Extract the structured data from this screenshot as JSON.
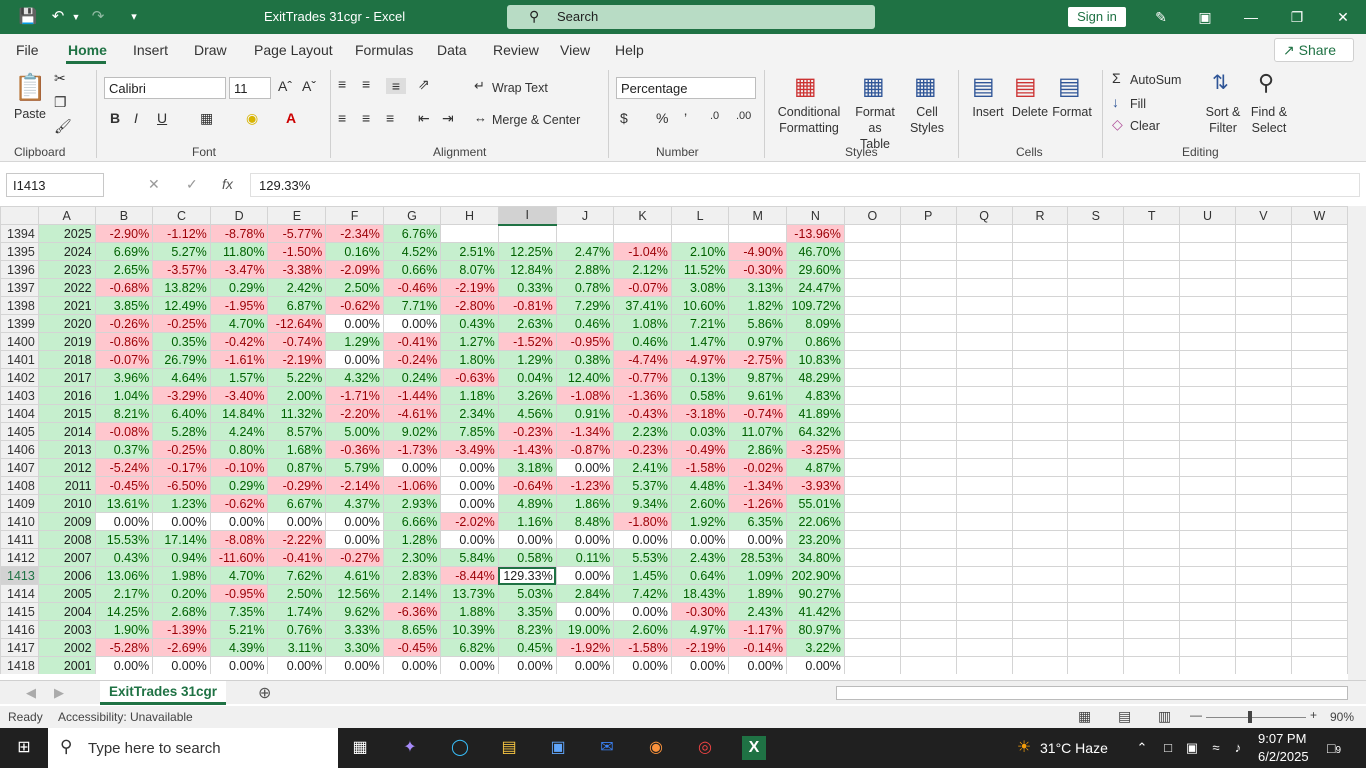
{
  "titlebar": {
    "doc_title": "ExitTrades 31cgr  -  Excel",
    "search_placeholder": "Search",
    "signin": "Sign in"
  },
  "menu": {
    "tabs": [
      "File",
      "Home",
      "Insert",
      "Draw",
      "Page Layout",
      "Formulas",
      "Data",
      "Review",
      "View",
      "Help"
    ],
    "active": "Home",
    "share": "Share"
  },
  "ribbon": {
    "clipboard": {
      "paste": "Paste",
      "group": "Clipboard"
    },
    "font": {
      "name": "Calibri",
      "size": "11",
      "group": "Font"
    },
    "alignment": {
      "wrap": "Wrap Text",
      "merge": "Merge & Center",
      "group": "Alignment"
    },
    "number": {
      "format": "Percentage",
      "group": "Number"
    },
    "styles": {
      "cond1": "Conditional",
      "cond2": "Formatting",
      "table1": "Format as",
      "table2": "Table",
      "cell1": "Cell",
      "cell2": "Styles",
      "group": "Styles"
    },
    "cells": {
      "insert": "Insert",
      "delete": "Delete",
      "format": "Format",
      "group": "Cells"
    },
    "editing": {
      "autosum": "AutoSum",
      "fill": "Fill",
      "clear": "Clear",
      "sort1": "Sort &",
      "sort2": "Filter",
      "find1": "Find &",
      "find2": "Select",
      "group": "Editing"
    }
  },
  "formula_bar": {
    "name_box": "I1413",
    "fx": "fx",
    "value": "129.33%"
  },
  "columns": [
    "A",
    "B",
    "C",
    "D",
    "E",
    "F",
    "G",
    "H",
    "I",
    "J",
    "K",
    "L",
    "M",
    "N",
    "O",
    "P",
    "Q",
    "R",
    "S",
    "T",
    "U",
    "V",
    "W"
  ],
  "rows": [
    {
      "n": "1394",
      "a": "2025",
      "v": [
        "-2.90%",
        "-1.12%",
        "-8.78%",
        "-5.77%",
        "-2.34%",
        "6.76%",
        "",
        "",
        "",
        "",
        "",
        "",
        "-13.96%"
      ]
    },
    {
      "n": "1395",
      "a": "2024",
      "v": [
        "6.69%",
        "5.27%",
        "11.80%",
        "-1.50%",
        "0.16%",
        "4.52%",
        "2.51%",
        "12.25%",
        "2.47%",
        "-1.04%",
        "2.10%",
        "-4.90%",
        "46.70%"
      ]
    },
    {
      "n": "1396",
      "a": "2023",
      "v": [
        "2.65%",
        "-3.57%",
        "-3.47%",
        "-3.38%",
        "-2.09%",
        "0.66%",
        "8.07%",
        "12.84%",
        "2.88%",
        "2.12%",
        "11.52%",
        "-0.30%",
        "29.60%"
      ]
    },
    {
      "n": "1397",
      "a": "2022",
      "v": [
        "-0.68%",
        "13.82%",
        "0.29%",
        "2.42%",
        "2.50%",
        "-0.46%",
        "-2.19%",
        "0.33%",
        "0.78%",
        "-0.07%",
        "3.08%",
        "3.13%",
        "24.47%"
      ]
    },
    {
      "n": "1398",
      "a": "2021",
      "v": [
        "3.85%",
        "12.49%",
        "-1.95%",
        "6.87%",
        "-0.62%",
        "7.71%",
        "-2.80%",
        "-0.81%",
        "7.29%",
        "37.41%",
        "10.60%",
        "1.82%",
        "109.72%"
      ]
    },
    {
      "n": "1399",
      "a": "2020",
      "v": [
        "-0.26%",
        "-0.25%",
        "4.70%",
        "-12.64%",
        "0.00%",
        "0.00%",
        "0.43%",
        "2.63%",
        "0.46%",
        "1.08%",
        "7.21%",
        "5.86%",
        "8.09%"
      ]
    },
    {
      "n": "1400",
      "a": "2019",
      "v": [
        "-0.86%",
        "0.35%",
        "-0.42%",
        "-0.74%",
        "1.29%",
        "-0.41%",
        "1.27%",
        "-1.52%",
        "-0.95%",
        "0.46%",
        "1.47%",
        "0.97%",
        "0.86%"
      ]
    },
    {
      "n": "1401",
      "a": "2018",
      "v": [
        "-0.07%",
        "26.79%",
        "-1.61%",
        "-2.19%",
        "0.00%",
        "-0.24%",
        "1.80%",
        "1.29%",
        "0.38%",
        "-4.74%",
        "-4.97%",
        "-2.75%",
        "10.83%"
      ]
    },
    {
      "n": "1402",
      "a": "2017",
      "v": [
        "3.96%",
        "4.64%",
        "1.57%",
        "5.22%",
        "4.32%",
        "0.24%",
        "-0.63%",
        "0.04%",
        "12.40%",
        "-0.77%",
        "0.13%",
        "9.87%",
        "48.29%"
      ]
    },
    {
      "n": "1403",
      "a": "2016",
      "v": [
        "1.04%",
        "-3.29%",
        "-3.40%",
        "2.00%",
        "-1.71%",
        "-1.44%",
        "1.18%",
        "3.26%",
        "-1.08%",
        "-1.36%",
        "0.58%",
        "9.61%",
        "4.83%"
      ]
    },
    {
      "n": "1404",
      "a": "2015",
      "v": [
        "8.21%",
        "6.40%",
        "14.84%",
        "11.32%",
        "-2.20%",
        "-4.61%",
        "2.34%",
        "4.56%",
        "0.91%",
        "-0.43%",
        "-3.18%",
        "-0.74%",
        "41.89%"
      ]
    },
    {
      "n": "1405",
      "a": "2014",
      "v": [
        "-0.08%",
        "5.28%",
        "4.24%",
        "8.57%",
        "5.00%",
        "9.02%",
        "7.85%",
        "-0.23%",
        "-1.34%",
        "2.23%",
        "0.03%",
        "11.07%",
        "64.32%"
      ]
    },
    {
      "n": "1406",
      "a": "2013",
      "v": [
        "0.37%",
        "-0.25%",
        "0.80%",
        "1.68%",
        "-0.36%",
        "-1.73%",
        "-3.49%",
        "-1.43%",
        "-0.87%",
        "-0.23%",
        "-0.49%",
        "2.86%",
        "-3.25%"
      ]
    },
    {
      "n": "1407",
      "a": "2012",
      "v": [
        "-5.24%",
        "-0.17%",
        "-0.10%",
        "0.87%",
        "5.79%",
        "0.00%",
        "0.00%",
        "3.18%",
        "0.00%",
        "2.41%",
        "-1.58%",
        "-0.02%",
        "4.87%"
      ]
    },
    {
      "n": "1408",
      "a": "2011",
      "v": [
        "-0.45%",
        "-6.50%",
        "0.29%",
        "-0.29%",
        "-2.14%",
        "-1.06%",
        "0.00%",
        "-0.64%",
        "-1.23%",
        "5.37%",
        "4.48%",
        "-1.34%",
        "-3.93%"
      ]
    },
    {
      "n": "1409",
      "a": "2010",
      "v": [
        "13.61%",
        "1.23%",
        "-0.62%",
        "6.67%",
        "4.37%",
        "2.93%",
        "0.00%",
        "4.89%",
        "1.86%",
        "9.34%",
        "2.60%",
        "-1.26%",
        "55.01%"
      ]
    },
    {
      "n": "1410",
      "a": "2009",
      "v": [
        "0.00%",
        "0.00%",
        "0.00%",
        "0.00%",
        "0.00%",
        "6.66%",
        "-2.02%",
        "1.16%",
        "8.48%",
        "-1.80%",
        "1.92%",
        "6.35%",
        "22.06%"
      ]
    },
    {
      "n": "1411",
      "a": "2008",
      "v": [
        "15.53%",
        "17.14%",
        "-8.08%",
        "-2.22%",
        "0.00%",
        "1.28%",
        "0.00%",
        "0.00%",
        "0.00%",
        "0.00%",
        "0.00%",
        "0.00%",
        "23.20%"
      ]
    },
    {
      "n": "1412",
      "a": "2007",
      "v": [
        "0.43%",
        "0.94%",
        "-11.60%",
        "-0.41%",
        "-0.27%",
        "2.30%",
        "5.84%",
        "0.58%",
        "0.11%",
        "5.53%",
        "2.43%",
        "28.53%",
        "34.80%"
      ]
    },
    {
      "n": "1413",
      "a": "2006",
      "v": [
        "13.06%",
        "1.98%",
        "4.70%",
        "7.62%",
        "4.61%",
        "2.83%",
        "-8.44%",
        "129.33%",
        "0.00%",
        "1.45%",
        "0.64%",
        "1.09%",
        "202.90%"
      ]
    },
    {
      "n": "1414",
      "a": "2005",
      "v": [
        "2.17%",
        "0.20%",
        "-0.95%",
        "2.50%",
        "12.56%",
        "2.14%",
        "13.73%",
        "5.03%",
        "2.84%",
        "7.42%",
        "18.43%",
        "1.89%",
        "90.27%"
      ]
    },
    {
      "n": "1415",
      "a": "2004",
      "v": [
        "14.25%",
        "2.68%",
        "7.35%",
        "1.74%",
        "9.62%",
        "-6.36%",
        "1.88%",
        "3.35%",
        "0.00%",
        "0.00%",
        "-0.30%",
        "2.43%",
        "41.42%"
      ]
    },
    {
      "n": "1416",
      "a": "2003",
      "v": [
        "1.90%",
        "-1.39%",
        "5.21%",
        "0.76%",
        "3.33%",
        "8.65%",
        "10.39%",
        "8.23%",
        "19.00%",
        "2.60%",
        "4.97%",
        "-1.17%",
        "80.97%"
      ]
    },
    {
      "n": "1417",
      "a": "2002",
      "v": [
        "-5.28%",
        "-2.69%",
        "4.39%",
        "3.11%",
        "3.30%",
        "-0.45%",
        "6.82%",
        "0.45%",
        "-1.92%",
        "-1.58%",
        "-2.19%",
        "-0.14%",
        "3.22%"
      ]
    },
    {
      "n": "1418",
      "a": "2001",
      "v": [
        "0.00%",
        "0.00%",
        "0.00%",
        "0.00%",
        "0.00%",
        "0.00%",
        "0.00%",
        "0.00%",
        "0.00%",
        "0.00%",
        "0.00%",
        "0.00%",
        "0.00%"
      ]
    }
  ],
  "sheet_tab": "ExitTrades 31cgr",
  "status": {
    "ready": "Ready",
    "accessibility": "Accessibility: Unavailable",
    "zoom": "90%"
  },
  "taskbar": {
    "search_placeholder": "Type here to search",
    "weather": "31°C  Haze",
    "time": "9:07 PM",
    "date": "6/2/2025",
    "notif": "9"
  },
  "colors": {
    "accent": "#1f7244",
    "pos_fill": "#c6efce",
    "neg_fill": "#ffc7ce"
  }
}
